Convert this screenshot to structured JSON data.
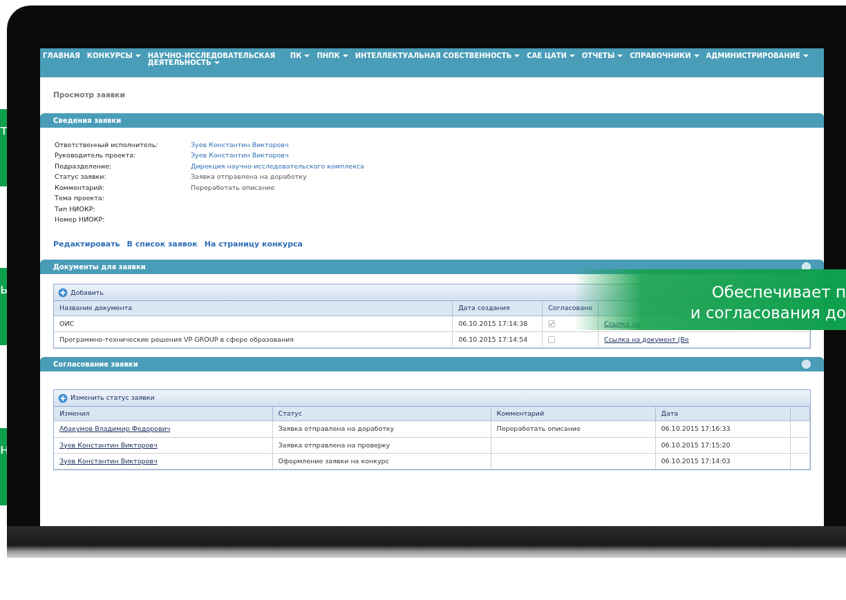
{
  "nav": [
    {
      "label": "ГЛАВНАЯ",
      "dropdown": false
    },
    {
      "label": "КОНКУРСЫ",
      "dropdown": true
    },
    {
      "label": "НАУЧНО-ИССЛЕДОВАТЕЛЬСКАЯ ДЕЯТЕЛЬНОСТЬ",
      "dropdown": true
    },
    {
      "label": "ПК",
      "dropdown": true
    },
    {
      "label": "ПНПК",
      "dropdown": true
    },
    {
      "label": "ИНТЕЛЛЕКТУАЛЬНАЯ СОБСТВЕННОСТЬ",
      "dropdown": true
    },
    {
      "label": "САЕ ЦАТИ",
      "dropdown": true
    },
    {
      "label": "ОТЧЕТЫ",
      "dropdown": true
    },
    {
      "label": "СПРАВОЧНИКИ",
      "dropdown": true
    },
    {
      "label": "АДМИНИСТРИРОВАНИЕ",
      "dropdown": true
    }
  ],
  "page_title": "Просмотр заявки",
  "details": {
    "title": "Сведения заявки",
    "fields": [
      {
        "label": "Ответственный исполнитель:",
        "value": "Зуев Константин Викторовч",
        "kind": "link"
      },
      {
        "label": "Руководитель проекта:",
        "value": "Зуев Константин Викторовч",
        "kind": "link"
      },
      {
        "label": "Подразделение:",
        "value": "Дирекция научно-исследовательского комплекса",
        "kind": "link"
      },
      {
        "label": "Статус заявки:",
        "value": "Заявка отправлена на доработку",
        "kind": "text"
      },
      {
        "label": "Комментарий:",
        "value": "Переработать описание",
        "kind": "text"
      },
      {
        "label": "Тема проекта:"
      },
      {
        "label": "Тип НИОКР:"
      },
      {
        "label": "Номер НИОКР:"
      }
    ],
    "actions": [
      "Редактировать",
      "В список заявок",
      "На страницу конкурса"
    ]
  },
  "documents": {
    "title": "Документы для заявки",
    "add_button": "Добавить",
    "columns": [
      "Название документа",
      "Дата создания",
      "Согласовано"
    ],
    "rows": [
      {
        "name": "ОИС",
        "date": "06.10.2015 17:14:38",
        "approved": true,
        "link": "Ссылка на"
      },
      {
        "name": "Программно-технические решения VP GROUP в сфере образования",
        "date": "06.10.2015 17:14:54",
        "approved": false,
        "link": "Ссылка на документ (Ве"
      }
    ]
  },
  "approval": {
    "title": "Согласование заявки",
    "add_button": "Изменить статус заявки",
    "columns": [
      "Изменил",
      "Статус",
      "Комментарий",
      "Дата"
    ],
    "rows": [
      {
        "changed_by": "Абакумов Владимир Федорович",
        "status": "Заявка отправлена на доработку",
        "comment": "Переработать описание",
        "date": "06.10.2015 17:16:33"
      },
      {
        "changed_by": "Зуев Константин Викторовч",
        "status": "Заявка отправлена на проверку",
        "date": "06.10.2015 17:15:20"
      },
      {
        "changed_by": "Зуев Константин Викторовч",
        "status": "Оформление заявки на конкурс",
        "date": "06.10.2015 17:14:03"
      }
    ]
  },
  "callout": {
    "lines": [
      "Обеспечивает п",
      "и согласования до"
    ]
  },
  "side_tabs": [
    "т",
    "ь",
    "н"
  ]
}
